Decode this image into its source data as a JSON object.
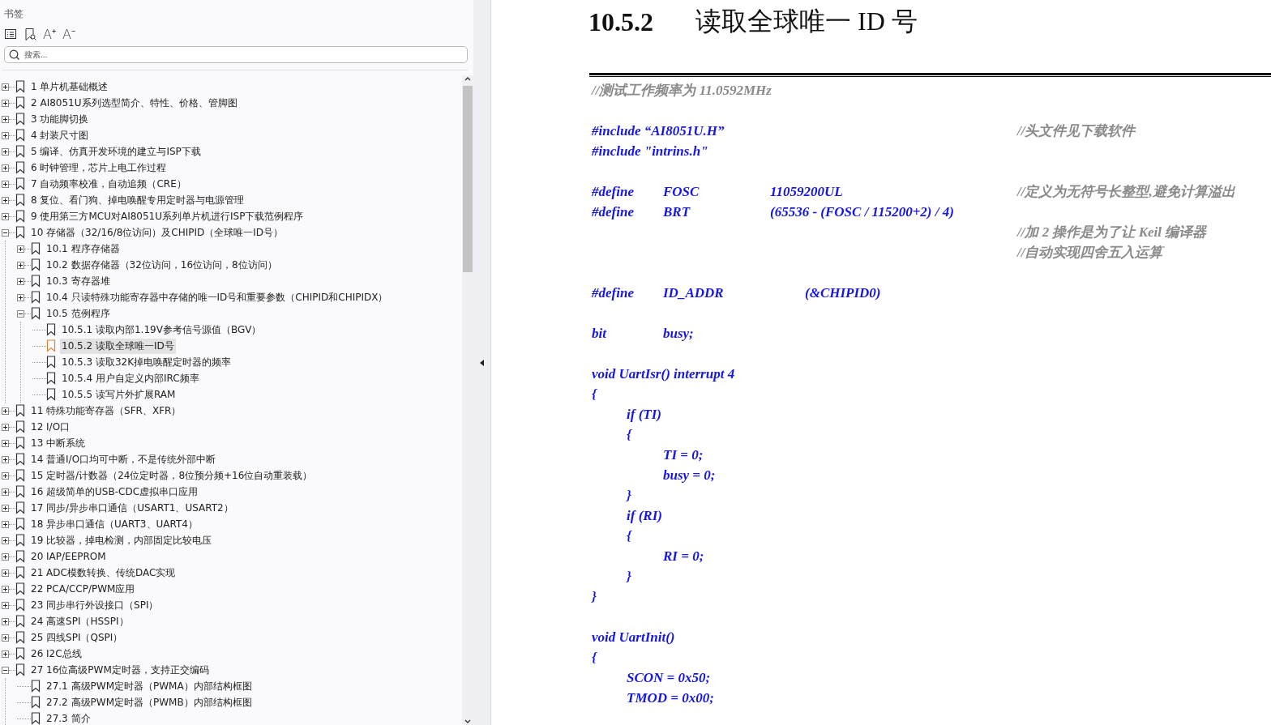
{
  "outline": {
    "title": "书签",
    "tools": [
      {
        "kind": "list"
      },
      {
        "kind": "bookmark-search"
      },
      {
        "kind": "text",
        "label": "A⁺"
      },
      {
        "kind": "text",
        "label": "A⁻"
      }
    ],
    "search": {
      "placeholder": "搜索..."
    },
    "items": [
      {
        "label": "1 单片机基础概述",
        "kind": "folder",
        "expanded": false,
        "selected": false
      },
      {
        "label": "2  AI8051U系列选型简介、特性、价格、管脚图",
        "kind": "folder",
        "expanded": false,
        "selected": false
      },
      {
        "label": "3  功能脚切换",
        "kind": "folder",
        "expanded": false,
        "selected": false
      },
      {
        "label": "4  封装尺寸图",
        "kind": "folder",
        "expanded": false,
        "selected": false
      },
      {
        "label": "5  编译、仿真开发环境的建立与ISP下载",
        "kind": "folder",
        "expanded": false,
        "selected": false
      },
      {
        "label": "6  时钟管理，芯片上电工作过程",
        "kind": "folder",
        "expanded": false,
        "selected": false
      },
      {
        "label": "7  自动频率校准，自动追频（CRE）",
        "kind": "folder",
        "expanded": false,
        "selected": false
      },
      {
        "label": "8  复位、看门狗、掉电唤醒专用定时器与电源管理",
        "kind": "folder",
        "expanded": false,
        "selected": false
      },
      {
        "label": "9  使用第三方MCU对AI8051U系列单片机进行ISP下载范例程序",
        "kind": "folder",
        "expanded": false,
        "selected": false
      },
      {
        "label": "10  存储器（32/16/8位访问）及CHIPID（全球唯一ID号）",
        "kind": "folder",
        "expanded": true,
        "selected": false,
        "children": [
          {
            "label": "10.1  程序存储器",
            "kind": "folder",
            "expanded": false,
            "selected": false
          },
          {
            "label": "10.2  数据存储器（32位访问，16位访问，8位访问）",
            "kind": "folder",
            "expanded": false,
            "selected": false
          },
          {
            "label": "10.3  寄存器堆",
            "kind": "folder",
            "expanded": false,
            "selected": false
          },
          {
            "label": "10.4  只读特殊功能寄存器中存储的唯一ID号和重要参数（CHIPID和CHIPIDX）",
            "kind": "folder",
            "expanded": false,
            "selected": false
          },
          {
            "label": "10.5  范例程序",
            "kind": "folder",
            "expanded": true,
            "selected": false,
            "children": [
              {
                "label": "10.5.1 读取内部1.19V参考信号源值（BGV）",
                "kind": "leaf",
                "selected": false
              },
              {
                "label": "10.5.2 读取全球唯一ID号",
                "kind": "leaf",
                "selected": true
              },
              {
                "label": "10.5.3 读取32K掉电唤醒定时器的频率",
                "kind": "leaf",
                "selected": false
              },
              {
                "label": "10.5.4 用户自定义内部IRC频率",
                "kind": "leaf",
                "selected": false
              },
              {
                "label": "10.5.5 读写片外扩展RAM",
                "kind": "leaf",
                "selected": false
              }
            ]
          }
        ]
      },
      {
        "label": "11  特殊功能寄存器（SFR、XFR）",
        "kind": "folder",
        "expanded": false,
        "selected": false
      },
      {
        "label": "12  I/O口",
        "kind": "folder",
        "expanded": false,
        "selected": false
      },
      {
        "label": "13  中断系统",
        "kind": "folder",
        "expanded": false,
        "selected": false
      },
      {
        "label": "14  普通I/O口均可中断，不是传统外部中断",
        "kind": "folder",
        "expanded": false,
        "selected": false
      },
      {
        "label": "15  定时器/计数器（24位定时器，8位预分频+16位自动重装载）",
        "kind": "folder",
        "expanded": false,
        "selected": false
      },
      {
        "label": "16  超级简单的USB-CDC虚拟串口应用",
        "kind": "folder",
        "expanded": false,
        "selected": false
      },
      {
        "label": "17  同步/异步串口通信（USART1、USART2）",
        "kind": "folder",
        "expanded": false,
        "selected": false
      },
      {
        "label": "18  异步串口通信（UART3、UART4）",
        "kind": "folder",
        "expanded": false,
        "selected": false
      },
      {
        "label": "19  比较器，掉电检测，内部固定比较电压",
        "kind": "folder",
        "expanded": false,
        "selected": false
      },
      {
        "label": "20  IAP/EEPROM",
        "kind": "folder",
        "expanded": false,
        "selected": false
      },
      {
        "label": "21  ADC模数转换、传统DAC实现",
        "kind": "folder",
        "expanded": false,
        "selected": false
      },
      {
        "label": "22  PCA/CCP/PWM应用",
        "kind": "folder",
        "expanded": false,
        "selected": false
      },
      {
        "label": "23  同步串行外设接口（SPI）",
        "kind": "folder",
        "expanded": false,
        "selected": false
      },
      {
        "label": "24  高速SPI（HSSPI）",
        "kind": "folder",
        "expanded": false,
        "selected": false
      },
      {
        "label": "25  四线SPI（QSPI）",
        "kind": "folder",
        "expanded": false,
        "selected": false
      },
      {
        "label": "26  I2C总线",
        "kind": "folder",
        "expanded": false,
        "selected": false
      },
      {
        "label": "27  16位高级PWM定时器，支持正交编码",
        "kind": "folder",
        "expanded": true,
        "selected": false,
        "children": [
          {
            "label": "27.1  高级PWM定时器（PWMA）内部结构框图",
            "kind": "leaf",
            "selected": false
          },
          {
            "label": "27.2  高级PWM定时器（PWMB）内部结构框图",
            "kind": "leaf",
            "selected": false
          },
          {
            "label": "27.3  简介",
            "kind": "leaf",
            "selected": false
          }
        ]
      }
    ]
  },
  "document": {
    "heading_number": "10.5.2",
    "heading_title": "读取全球唯一 ID 号",
    "lines": [
      {
        "kind": "comment",
        "cells": [
          "//测试工作频率为 11.0592MHz"
        ]
      },
      {
        "kind": "blank"
      },
      {
        "kind": "code",
        "cells": [
          "#include “AI8051U.H”"
        ],
        "note": "//头文件见下载软件"
      },
      {
        "kind": "code",
        "cells": [
          "#include \"intrins.h\""
        ]
      },
      {
        "kind": "blank"
      },
      {
        "kind": "define",
        "cells": [
          "#define",
          "FOSC",
          "11059200UL"
        ],
        "note": "//定义为无符号长整型,避免计算溢出"
      },
      {
        "kind": "define",
        "cells": [
          "#define",
          "BRT",
          "(65536 - (FOSC / 115200+2) / 4)"
        ]
      },
      {
        "kind": "note",
        "note": "//加 2 操作是为了让 Keil 编译器"
      },
      {
        "kind": "note",
        "note": "//自动实现四舍五入运算"
      },
      {
        "kind": "blank"
      },
      {
        "kind": "define_wide",
        "cells": [
          "#define",
          "ID_ADDR",
          "(&CHIPID0)"
        ]
      },
      {
        "kind": "blank"
      },
      {
        "kind": "define",
        "cells": [
          "bit",
          "busy;"
        ]
      },
      {
        "kind": "blank"
      },
      {
        "kind": "code",
        "cells": [
          "void UartIsr() interrupt 4"
        ]
      },
      {
        "kind": "code",
        "cells": [
          "{"
        ]
      },
      {
        "kind": "nested",
        "cells": [
          "if (TI)"
        ]
      },
      {
        "kind": "nested",
        "cells": [
          "{"
        ]
      },
      {
        "kind": "inner",
        "cells": [
          "TI = 0;"
        ]
      },
      {
        "kind": "inner",
        "cells": [
          "busy = 0;"
        ]
      },
      {
        "kind": "nested",
        "cells": [
          "}"
        ]
      },
      {
        "kind": "nested",
        "cells": [
          "if (RI)"
        ]
      },
      {
        "kind": "nested",
        "cells": [
          "{"
        ]
      },
      {
        "kind": "inner",
        "cells": [
          "RI = 0;"
        ]
      },
      {
        "kind": "nested",
        "cells": [
          "}"
        ]
      },
      {
        "kind": "code",
        "cells": [
          "}"
        ]
      },
      {
        "kind": "blank"
      },
      {
        "kind": "code",
        "cells": [
          "void UartInit()"
        ]
      },
      {
        "kind": "code",
        "cells": [
          "{"
        ]
      },
      {
        "kind": "nested",
        "cells": [
          "SCON = 0x50;"
        ]
      },
      {
        "kind": "nested",
        "cells": [
          "TMOD = 0x00;"
        ]
      }
    ]
  }
}
